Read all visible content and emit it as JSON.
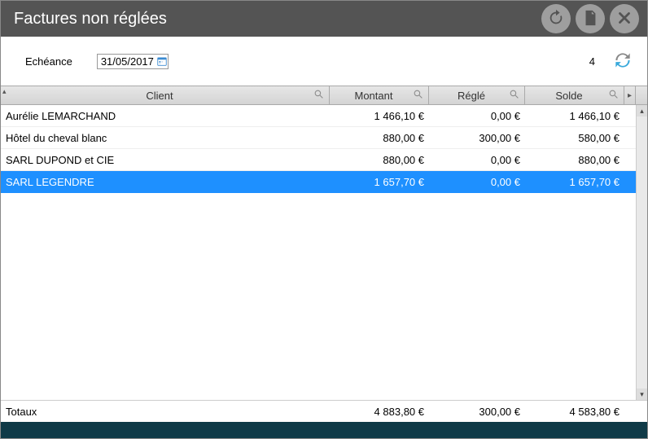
{
  "title": "Factures non réglées",
  "filter": {
    "label": "Echéance",
    "date": "31/05/2017",
    "count": "4"
  },
  "columns": {
    "client": "Client",
    "montant": "Montant",
    "regle": "Réglé",
    "solde": "Solde"
  },
  "rows": [
    {
      "client": "Aurélie LEMARCHAND",
      "montant": "1 466,10 €",
      "regle": "0,00 €",
      "solde": "1 466,10 €",
      "selected": false
    },
    {
      "client": "Hôtel du cheval blanc",
      "montant": "880,00 €",
      "regle": "300,00 €",
      "solde": "580,00 €",
      "selected": false
    },
    {
      "client": "SARL DUPOND et CIE",
      "montant": "880,00 €",
      "regle": "0,00 €",
      "solde": "880,00 €",
      "selected": false
    },
    {
      "client": "SARL LEGENDRE",
      "montant": "1 657,70 €",
      "regle": "0,00 €",
      "solde": "1 657,70 €",
      "selected": true
    }
  ],
  "totals": {
    "label": "Totaux",
    "montant": "4 883,80 €",
    "regle": "300,00 €",
    "solde": "4 583,80 €"
  }
}
